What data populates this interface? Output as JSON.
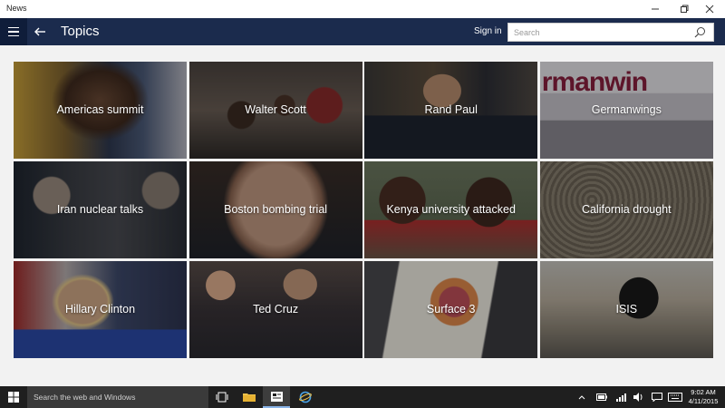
{
  "window": {
    "title": "News"
  },
  "header": {
    "page_title": "Topics",
    "sign_in_label": "Sign in",
    "search_placeholder": "Search"
  },
  "tiles": [
    {
      "label": "Americas summit"
    },
    {
      "label": "Walter Scott"
    },
    {
      "label": "Rand Paul"
    },
    {
      "label": "Germanwings",
      "image_text": "rmanwin"
    },
    {
      "label": "Iran nuclear talks"
    },
    {
      "label": "Boston bombing trial"
    },
    {
      "label": "Kenya university attacked"
    },
    {
      "label": "California drought"
    },
    {
      "label": "Hillary Clinton"
    },
    {
      "label": "Ted Cruz"
    },
    {
      "label": "Surface 3"
    },
    {
      "label": "ISIS"
    }
  ],
  "taskbar": {
    "search_placeholder": "Search the web and Windows",
    "time": "9:02 AM",
    "date": "4/11/2015"
  },
  "colors": {
    "header_bg": "#1b2b4d",
    "hamburger_bg": "#0f1d3a",
    "page_bg": "#f2f2f2",
    "taskbar_bg": "#1f1f1f"
  }
}
